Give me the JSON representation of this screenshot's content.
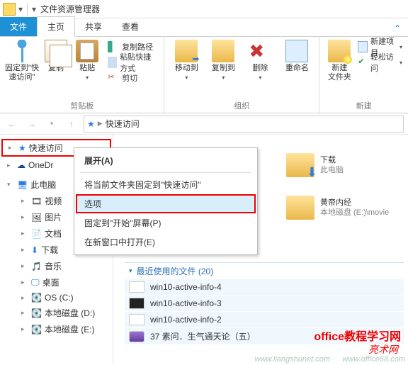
{
  "titlebar": {
    "title": "文件资源管理器"
  },
  "tabs": {
    "file": "文件",
    "home": "主页",
    "share": "共享",
    "view": "查看"
  },
  "ribbon": {
    "clipboard": {
      "pin": "固定到\"快\n速访问\"",
      "copy": "复制",
      "paste": "粘贴",
      "copy_path": "复制路径",
      "paste_shortcut": "粘贴快捷方式",
      "cut": "剪切",
      "group_label": "剪贴板"
    },
    "organize": {
      "move_to": "移动到",
      "copy_to": "复制到",
      "delete": "删除",
      "rename": "重命名",
      "group_label": "组织"
    },
    "new": {
      "new_folder": "新建\n文件夹",
      "new_item": "新建项目",
      "easy_access": "轻松访问",
      "group_label": "新建"
    }
  },
  "breadcrumb": {
    "location": "快速访问"
  },
  "sidebar": {
    "quick_access": "快速访问",
    "onedrive": "OneDr",
    "this_pc": "此电脑",
    "videos": "视频",
    "pictures": "图片",
    "documents": "文档",
    "downloads": "下载",
    "music": "音乐",
    "desktop": "桌面",
    "os_c": "OS (C:)",
    "disk_d": "本地磁盘 (D:)",
    "disk_e": "本地磁盘 (E:)"
  },
  "context_menu": {
    "expand": "展开(A)",
    "pin_current": "将当前文件夹固定到\"快速访问\"",
    "options": "选项",
    "pin_start": "固定到\"开始\"屏幕(P)",
    "open_new": "在新窗口中打开(E)"
  },
  "content": {
    "folders": [
      {
        "name": "下载",
        "sub": "此电脑"
      },
      {
        "name": "黄帝内经",
        "sub": "本地磁盘 (E:)\\movie"
      }
    ],
    "recent_header": "最近使用的文件 (20)",
    "recent_files": [
      {
        "name": "win10-active-info-4",
        "kind": "doc"
      },
      {
        "name": "win10-active-info-3",
        "kind": "black"
      },
      {
        "name": "win10-active-info-2",
        "kind": "doc"
      },
      {
        "name": "37 素问．生气通天论（五）",
        "kind": "purple"
      }
    ]
  },
  "watermarks": {
    "w1": "office教程学习网",
    "w2": "亮术网",
    "w3": "www.liangshunet.com",
    "w4": "www.office68.com"
  }
}
